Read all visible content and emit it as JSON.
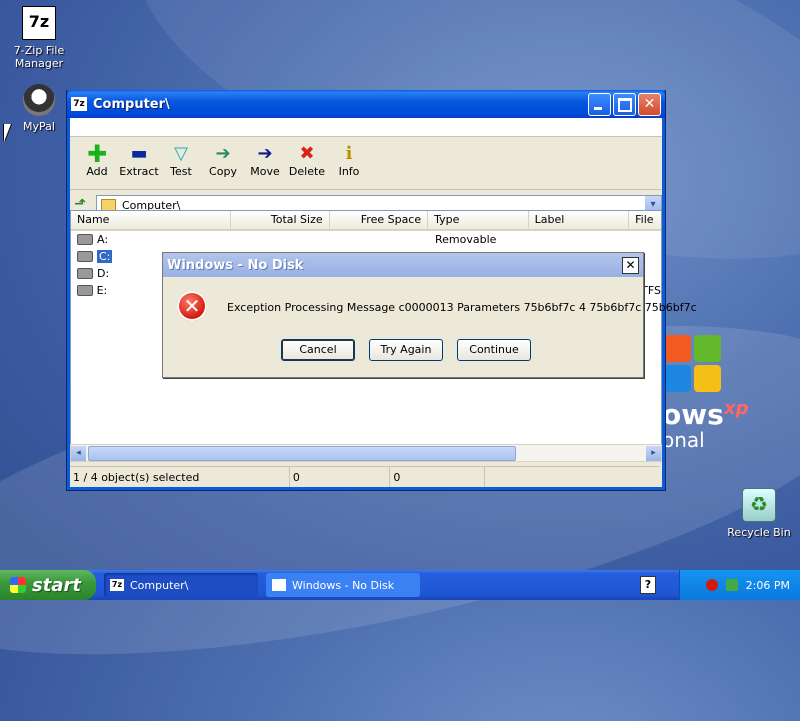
{
  "desktop": {
    "icons": [
      {
        "label_line1": "7-Zip File",
        "label_line2": "Manager",
        "glyph": "7z"
      },
      {
        "label": "MyPal"
      },
      {
        "label": "Recycle Bin",
        "glyph": "♻"
      }
    ],
    "xp_logo": {
      "text": "ows",
      "sup": "xp",
      "sub": "onal"
    }
  },
  "window": {
    "title": "Computer\\",
    "title_icon": "7z",
    "close_glyph": "✕",
    "toolbar": [
      {
        "label": "Add",
        "icon": "add-icon",
        "glyph": "✚"
      },
      {
        "label": "Extract",
        "icon": "extract-icon",
        "glyph": "▬"
      },
      {
        "label": "Test",
        "icon": "test-icon",
        "glyph": "▽"
      },
      {
        "label": "Copy",
        "icon": "copy-icon",
        "glyph": "➔"
      },
      {
        "label": "Move",
        "icon": "move-icon",
        "glyph": "➔"
      },
      {
        "label": "Delete",
        "icon": "delete-icon",
        "glyph": "✖"
      },
      {
        "label": "Info",
        "icon": "info-icon",
        "glyph": "i"
      }
    ],
    "up_glyph": "⬏",
    "address": "Computer\\",
    "dropdown_glyph": "▾",
    "columns": [
      "Name",
      "Total Size",
      "Free Space",
      "Type",
      "Label",
      "File"
    ],
    "rows": [
      {
        "name": "A:",
        "type": "Removable",
        "label": "",
        "extra": ""
      },
      {
        "name": "C:",
        "type": "",
        "label": "",
        "extra": ""
      },
      {
        "name": "D:",
        "type": "",
        "label": "",
        "extra": ""
      },
      {
        "name": "E:",
        "type": "",
        "label": "",
        "extra": "TFS"
      }
    ],
    "scroll_left": "◂",
    "scroll_right": "▸",
    "status": [
      "1 / 4 object(s) selected",
      "0",
      "0",
      ""
    ]
  },
  "dialog": {
    "title": "Windows - No Disk",
    "close_glyph": "✕",
    "error_glyph": "✕",
    "message": "Exception Processing Message c0000013 Parameters 75b6bf7c 4 75b6bf7c 75b6bf7c",
    "buttons": [
      "Cancel",
      "Try Again",
      "Continue"
    ]
  },
  "taskbar": {
    "start_label": "start",
    "tasks": [
      {
        "label": "Computer\\",
        "icon": "7z",
        "active": true
      },
      {
        "label": "Windows - No Disk",
        "icon": "",
        "active": false
      }
    ],
    "help_glyph": "?",
    "time": "2:06 PM"
  }
}
